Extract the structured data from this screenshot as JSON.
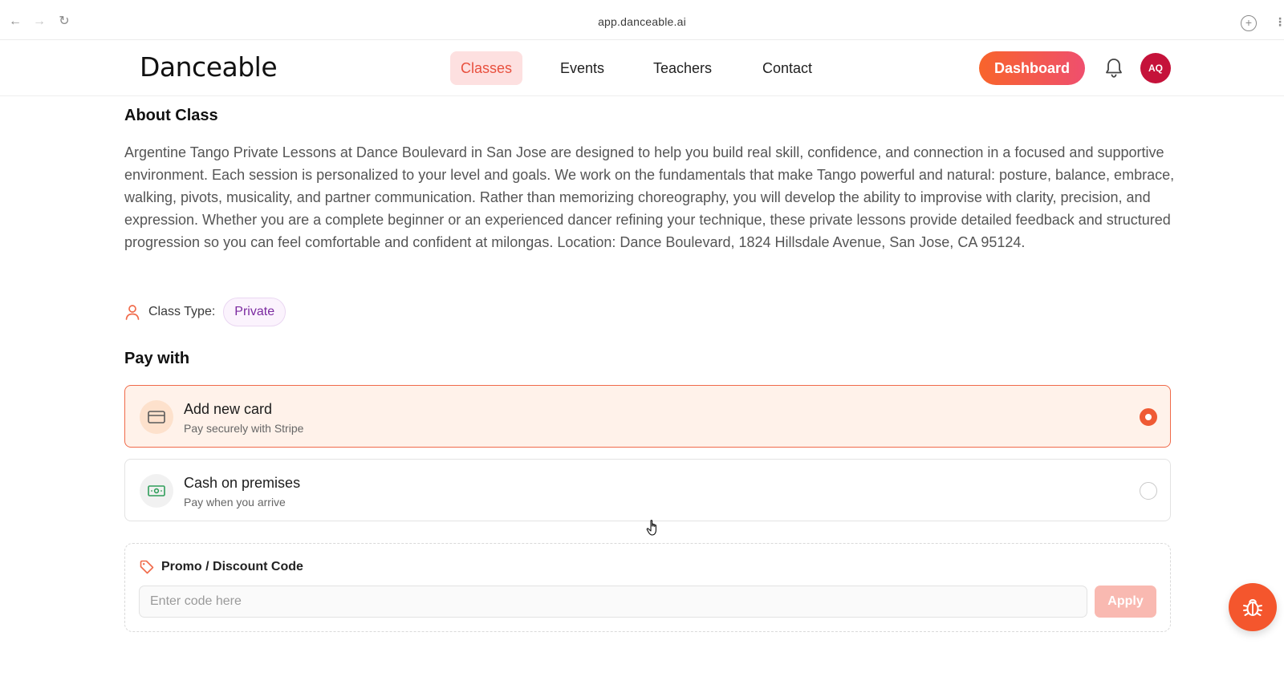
{
  "browser": {
    "url": "app.danceable.ai",
    "back_icon": "←",
    "forward_icon": "→",
    "reload_icon": "↻",
    "add_icon": "+",
    "more_icon": "⋮"
  },
  "header": {
    "logo": "Danceable",
    "nav": [
      "Classes",
      "Events",
      "Teachers",
      "Contact"
    ],
    "active_nav": "Classes",
    "dashboard_label": "Dashboard",
    "avatar_initials": "AQ"
  },
  "about": {
    "title": "About Class",
    "text": "Argentine Tango Private Lessons at Dance Boulevard in San Jose are designed to help you build real skill, confidence, and connection in a focused and supportive environment. Each session is personalized to your level and goals. We work on the fundamentals that make Tango powerful and natural: posture, balance, embrace, walking, pivots, musicality, and partner communication. Rather than memorizing choreography, you will develop the ability to improvise with clarity, precision, and expression. Whether you are a complete beginner or an experienced dancer refining your technique, these private lessons provide detailed feedback and structured progression so you can feel comfortable and confident at milongas. Location: Dance Boulevard, 1824 Hillsdale Avenue, San Jose, CA 95124.",
    "class_type_label": "Class Type:",
    "class_type_value": "Private"
  },
  "payment": {
    "title": "Pay with",
    "options": [
      {
        "title": "Add new card",
        "subtitle": "Pay securely with Stripe",
        "icon": "credit-card-icon",
        "selected": true
      },
      {
        "title": "Cash on premises",
        "subtitle": "Pay when you arrive",
        "icon": "cash-icon",
        "selected": false
      }
    ]
  },
  "promo": {
    "label": "Promo / Discount Code",
    "placeholder": "Enter code here",
    "value": "",
    "apply_label": "Apply"
  },
  "colors": {
    "accent": "#f06a4a",
    "nav_active_bg": "#fde0e0",
    "avatar_bg": "#c5123a",
    "pill_text": "#7b2aa0",
    "fab_bg": "#f4562d"
  }
}
